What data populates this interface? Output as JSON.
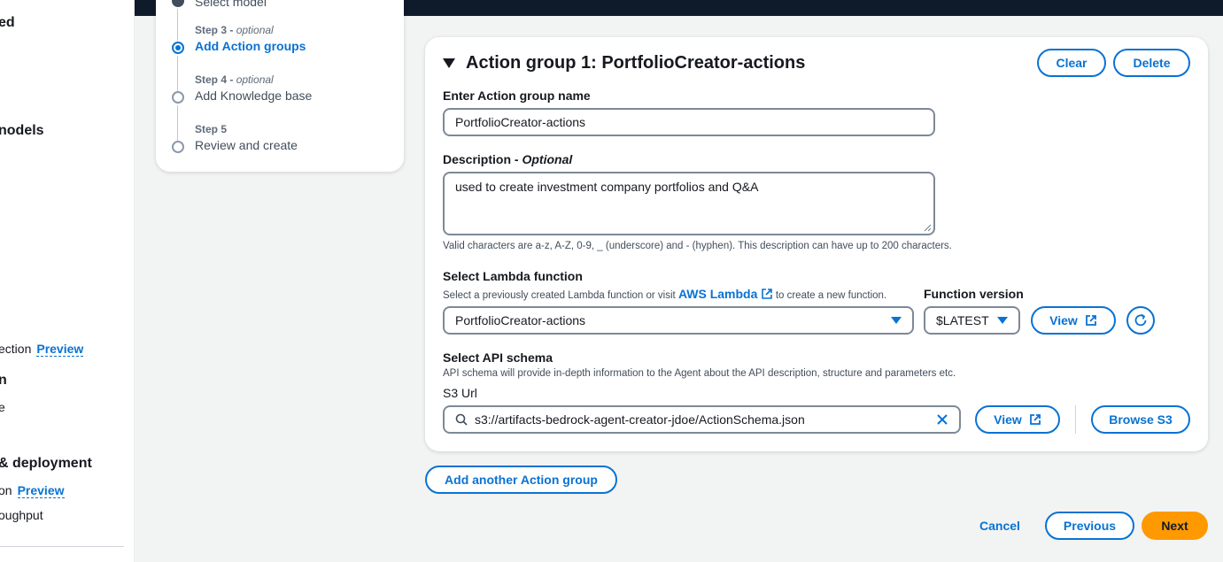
{
  "leftnav": {
    "items": [
      {
        "text": "ed",
        "bold": true
      },
      {
        "text": "nodels",
        "bold": true
      },
      {
        "text": "ection",
        "badge": "Preview"
      },
      {
        "text": "n",
        "bold": true
      },
      {
        "text": "e"
      },
      {
        "text": "& deployment",
        "bold": true
      },
      {
        "text": "on",
        "badge": "Preview"
      },
      {
        "text": "oughput"
      }
    ]
  },
  "steps": {
    "top_partial": "Select model",
    "items": [
      {
        "label": "Step 3",
        "optional": "optional",
        "title": "Add Action groups",
        "state": "active"
      },
      {
        "label": "Step 4",
        "optional": "optional",
        "title": "Add Knowledge base",
        "state": "pending"
      },
      {
        "label": "Step 5",
        "optional": "",
        "title": "Review and create",
        "state": "pending"
      }
    ]
  },
  "action_group": {
    "title": "Action group 1: PortfolioCreator-actions",
    "clear_label": "Clear",
    "delete_label": "Delete",
    "name_label": "Enter Action group name",
    "name_value": "PortfolioCreator-actions",
    "description_label": "Description - ",
    "description_optional": "Optional",
    "description_value": "used to create investment company portfolios and Q&A",
    "description_hint": "Valid characters are a-z, A-Z, 0-9, _ (underscore) and - (hyphen). This description can have up to 200 characters.",
    "lambda_label": "Select Lambda function",
    "lambda_hint_pre": "Select a previously created Lambda function or visit",
    "lambda_hint_link": "AWS Lambda",
    "lambda_hint_post": "to create a new function.",
    "lambda_value": "PortfolioCreator-actions",
    "version_label": "Function version",
    "version_value": "$LATEST",
    "view_label": "View",
    "schema_label": "Select API schema",
    "schema_hint": "API schema will provide in-depth information to the Agent about the API description, structure and parameters etc.",
    "s3_label": "S3 Url",
    "s3_value": "s3://artifacts-bedrock-agent-creator-jdoe/ActionSchema.json",
    "s3_view_label": "View",
    "browse_label": "Browse S3"
  },
  "add_another_label": "Add another Action group",
  "footer": {
    "cancel": "Cancel",
    "previous": "Previous",
    "next": "Next"
  },
  "colors": {
    "accent": "#0972d3",
    "primary": "#ff9900",
    "header": "#0f1b2a"
  }
}
